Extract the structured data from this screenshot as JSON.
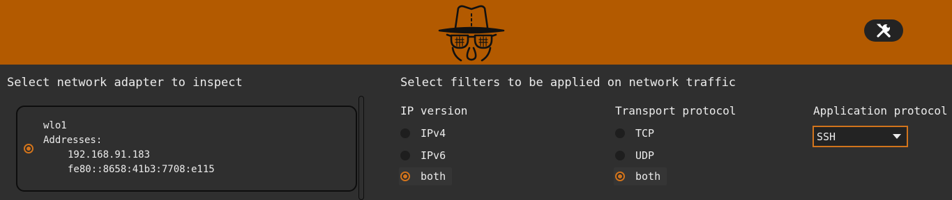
{
  "header": {
    "logo_icon": "spy-hat-glasses-icon",
    "settings_icon": "wrench-screwdriver-icon",
    "background_color": "#b35a00"
  },
  "adapters": {
    "title": "Select network adapter to inspect",
    "items": [
      {
        "name": "wlo1",
        "addresses_label": "Addresses:",
        "addresses": [
          "192.168.91.183",
          "fe80::8658:41b3:7708:e115"
        ],
        "selected": true
      }
    ]
  },
  "filters": {
    "title": "Select filters to be applied on network traffic",
    "ip_version": {
      "label": "IP version",
      "options": [
        "IPv4",
        "IPv6",
        "both"
      ],
      "selected": "both"
    },
    "transport": {
      "label": "Transport protocol",
      "options": [
        "TCP",
        "UDP",
        "both"
      ],
      "selected": "both"
    },
    "application": {
      "label": "Application protocol",
      "value": "SSH"
    }
  },
  "colors": {
    "accent": "#d2741c",
    "background": "#2f2f2f"
  }
}
